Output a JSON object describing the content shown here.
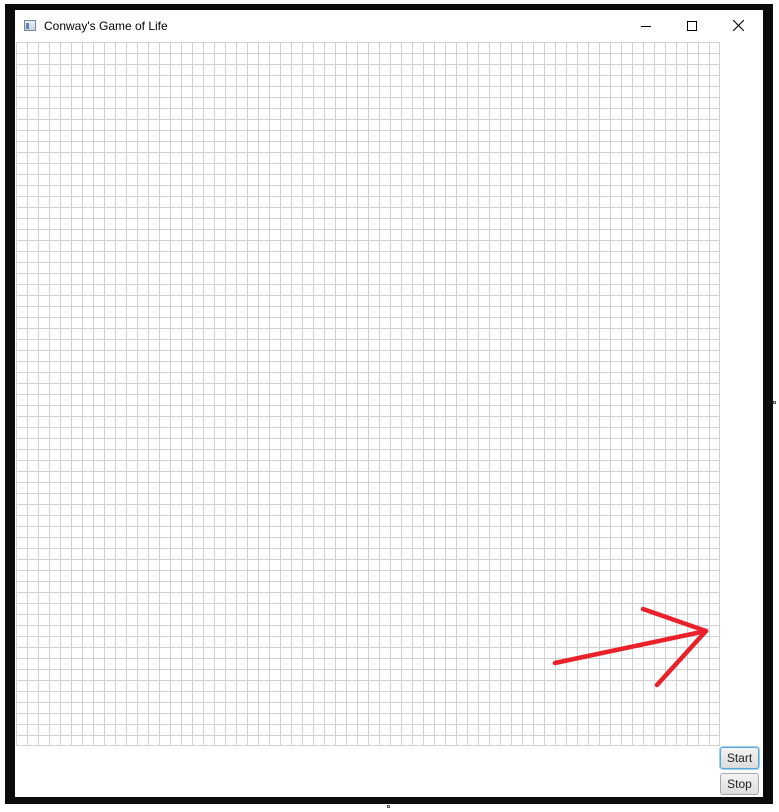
{
  "window": {
    "title": "Conway's Game of Life",
    "controls": {
      "minimize_icon": "minimize-icon",
      "maximize_icon": "maximize-icon",
      "close_icon": "close-icon"
    }
  },
  "grid": {
    "columns": 64,
    "rows": 64,
    "cell_color": "#ffffff",
    "line_color": "#d0d0d0"
  },
  "controls": {
    "start_label": "Start",
    "stop_label": "Stop"
  },
  "annotation": {
    "type": "arrow",
    "color": "#e8212b"
  }
}
